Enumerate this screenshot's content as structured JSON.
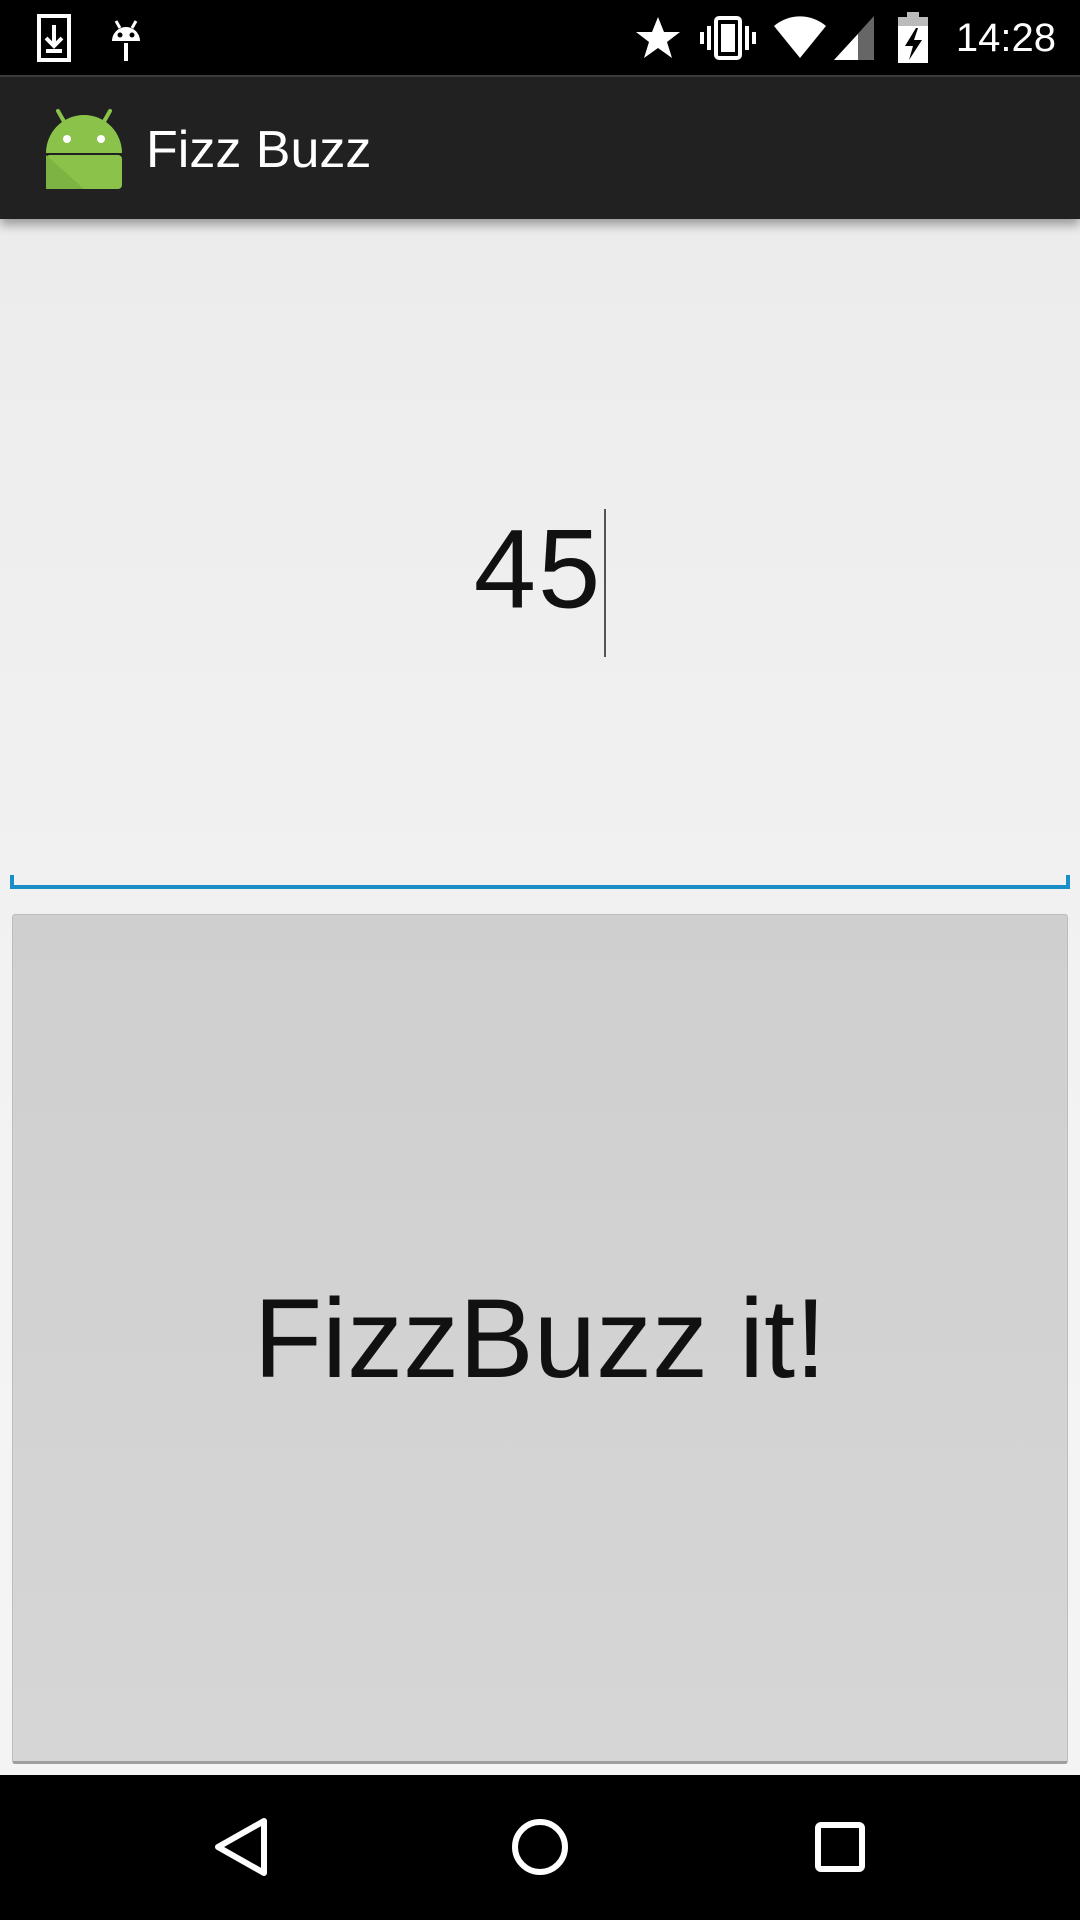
{
  "status_bar": {
    "time": "14:28",
    "icons": [
      "download-icon",
      "debug-icon",
      "star-icon",
      "vibrate-icon",
      "wifi-icon",
      "signal-icon",
      "battery-charging-icon"
    ]
  },
  "action_bar": {
    "app_icon": "android-icon",
    "title": "Fizz Buzz"
  },
  "main": {
    "number_input": {
      "value": "45"
    },
    "submit_button": {
      "label": "FizzBuzz it!"
    }
  },
  "nav_bar": {
    "buttons": [
      "back-icon",
      "home-icon",
      "recents-icon"
    ]
  },
  "colors": {
    "accent": "#1a8fc7",
    "android_green": "#8bc34a"
  }
}
